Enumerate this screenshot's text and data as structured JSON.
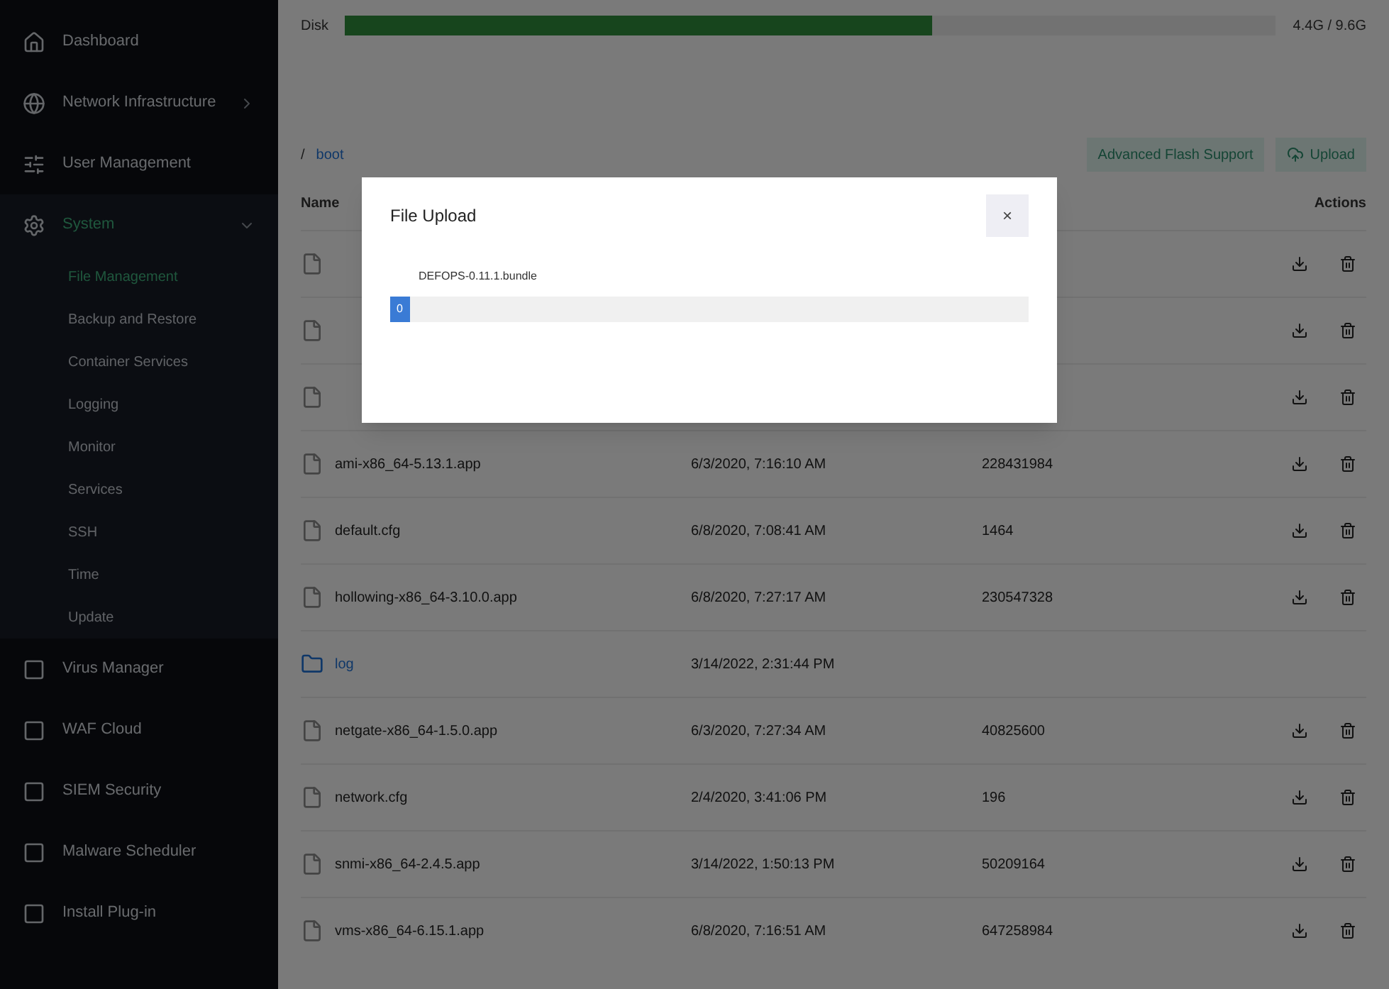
{
  "sidebar": {
    "items": [
      {
        "label": "Dashboard",
        "selected": false
      },
      {
        "label": "Network Infrastructure",
        "selected": false,
        "expanded": false
      },
      {
        "label": "User Management",
        "selected": false
      },
      {
        "label": "System",
        "selected": true,
        "expanded": true,
        "children": [
          {
            "label": "File Management",
            "selected": true
          },
          {
            "label": "Backup and Restore",
            "selected": false
          },
          {
            "label": "Container Services",
            "selected": false
          },
          {
            "label": "Logging",
            "selected": false
          },
          {
            "label": "Monitor",
            "selected": false
          },
          {
            "label": "Services",
            "selected": false
          },
          {
            "label": "SSH",
            "selected": false
          },
          {
            "label": "Time",
            "selected": false
          },
          {
            "label": "Update",
            "selected": false
          }
        ]
      },
      {
        "label": "Virus Manager",
        "selected": false
      },
      {
        "label": "WAF Cloud",
        "selected": false
      },
      {
        "label": "SIEM Security",
        "selected": false
      },
      {
        "label": "Malware Scheduler",
        "selected": false
      },
      {
        "label": "Install Plug-in",
        "selected": false
      }
    ]
  },
  "disk": {
    "label": "Disk",
    "level": 0.63,
    "reading": "4.4G / 9.6G"
  },
  "breadcrumb": [
    "/",
    "boot"
  ],
  "toolbar": {
    "buttons": [
      {
        "label": "Advanced Flash Support",
        "kind": "text"
      },
      {
        "label": "Upload",
        "kind": "upload"
      }
    ]
  },
  "table": {
    "columns": [
      "Name",
      "",
      "",
      "Actions"
    ],
    "rows": [
      {
        "kind": "file"
      },
      {
        "kind": "file"
      },
      {
        "kind": "file"
      },
      {
        "kind": "file",
        "name": "ami-x86_64-5.13.1.app",
        "modified": "6/3/2020, 7:16:10 AM",
        "size": "228431984"
      },
      {
        "kind": "file",
        "name": "default.cfg",
        "modified": "6/8/2020, 7:08:41 AM",
        "size": "1464"
      },
      {
        "kind": "file",
        "name": "hollowing-x86_64-3.10.0.app",
        "modified": "6/8/2020, 7:27:17 AM",
        "size": "230547328"
      },
      {
        "kind": "folder",
        "name": "log",
        "modified": "3/14/2022, 2:31:44 PM"
      },
      {
        "kind": "file",
        "name": "netgate-x86_64-1.5.0.app",
        "modified": "6/3/2020, 7:27:34 AM",
        "size": "40825600"
      },
      {
        "kind": "file",
        "name": "network.cfg",
        "modified": "2/4/2020, 3:41:06 PM",
        "size": "196"
      },
      {
        "kind": "file",
        "name": "snmi-x86_64-2.4.5.app",
        "modified": "3/14/2022, 1:50:13 PM",
        "size": "50209164"
      },
      {
        "kind": "file",
        "name": "vms-x86_64-6.15.1.app",
        "modified": "6/8/2020, 7:16:51 AM",
        "size": "647258984"
      }
    ]
  },
  "dialog": {
    "title": "File Upload",
    "close": "×",
    "file": "DEFOPS-0.11.1.bundle",
    "progress": {
      "level": 0.03,
      "reading": "0"
    }
  }
}
